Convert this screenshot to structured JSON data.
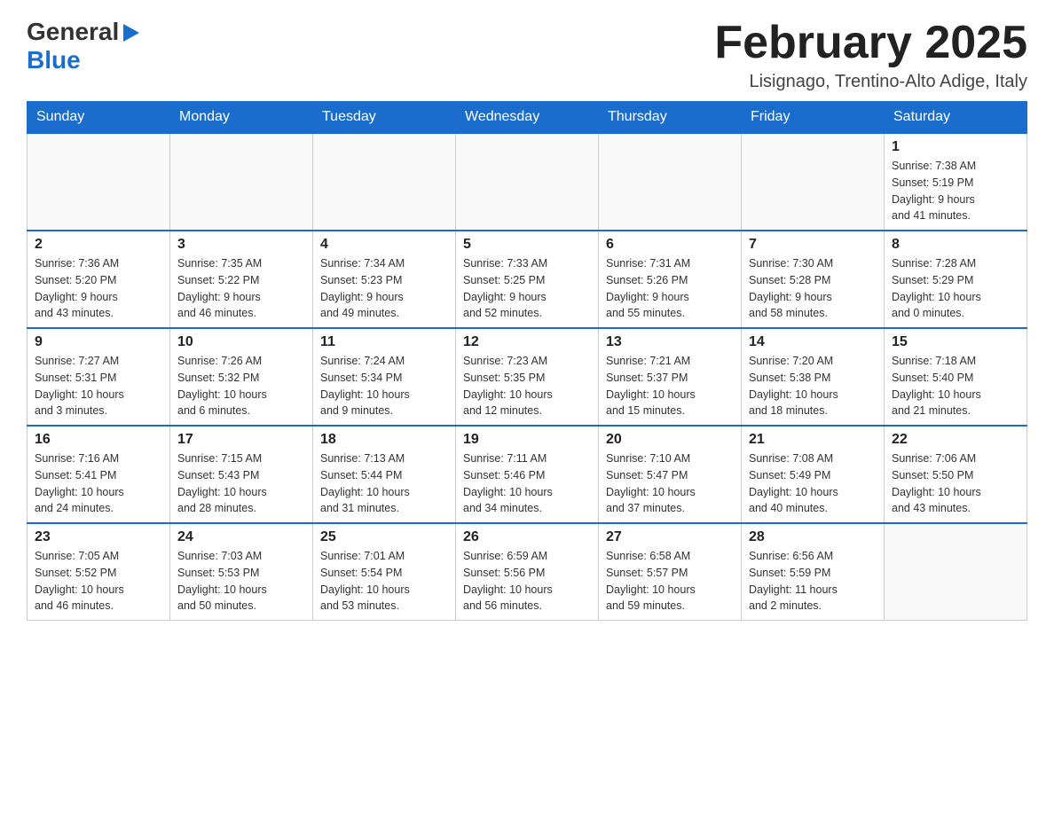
{
  "logo": {
    "general": "General",
    "blue": "Blue"
  },
  "title": "February 2025",
  "subtitle": "Lisignago, Trentino-Alto Adige, Italy",
  "weekdays": [
    "Sunday",
    "Monday",
    "Tuesday",
    "Wednesday",
    "Thursday",
    "Friday",
    "Saturday"
  ],
  "weeks": [
    [
      {
        "day": "",
        "info": ""
      },
      {
        "day": "",
        "info": ""
      },
      {
        "day": "",
        "info": ""
      },
      {
        "day": "",
        "info": ""
      },
      {
        "day": "",
        "info": ""
      },
      {
        "day": "",
        "info": ""
      },
      {
        "day": "1",
        "info": "Sunrise: 7:38 AM\nSunset: 5:19 PM\nDaylight: 9 hours\nand 41 minutes."
      }
    ],
    [
      {
        "day": "2",
        "info": "Sunrise: 7:36 AM\nSunset: 5:20 PM\nDaylight: 9 hours\nand 43 minutes."
      },
      {
        "day": "3",
        "info": "Sunrise: 7:35 AM\nSunset: 5:22 PM\nDaylight: 9 hours\nand 46 minutes."
      },
      {
        "day": "4",
        "info": "Sunrise: 7:34 AM\nSunset: 5:23 PM\nDaylight: 9 hours\nand 49 minutes."
      },
      {
        "day": "5",
        "info": "Sunrise: 7:33 AM\nSunset: 5:25 PM\nDaylight: 9 hours\nand 52 minutes."
      },
      {
        "day": "6",
        "info": "Sunrise: 7:31 AM\nSunset: 5:26 PM\nDaylight: 9 hours\nand 55 minutes."
      },
      {
        "day": "7",
        "info": "Sunrise: 7:30 AM\nSunset: 5:28 PM\nDaylight: 9 hours\nand 58 minutes."
      },
      {
        "day": "8",
        "info": "Sunrise: 7:28 AM\nSunset: 5:29 PM\nDaylight: 10 hours\nand 0 minutes."
      }
    ],
    [
      {
        "day": "9",
        "info": "Sunrise: 7:27 AM\nSunset: 5:31 PM\nDaylight: 10 hours\nand 3 minutes."
      },
      {
        "day": "10",
        "info": "Sunrise: 7:26 AM\nSunset: 5:32 PM\nDaylight: 10 hours\nand 6 minutes."
      },
      {
        "day": "11",
        "info": "Sunrise: 7:24 AM\nSunset: 5:34 PM\nDaylight: 10 hours\nand 9 minutes."
      },
      {
        "day": "12",
        "info": "Sunrise: 7:23 AM\nSunset: 5:35 PM\nDaylight: 10 hours\nand 12 minutes."
      },
      {
        "day": "13",
        "info": "Sunrise: 7:21 AM\nSunset: 5:37 PM\nDaylight: 10 hours\nand 15 minutes."
      },
      {
        "day": "14",
        "info": "Sunrise: 7:20 AM\nSunset: 5:38 PM\nDaylight: 10 hours\nand 18 minutes."
      },
      {
        "day": "15",
        "info": "Sunrise: 7:18 AM\nSunset: 5:40 PM\nDaylight: 10 hours\nand 21 minutes."
      }
    ],
    [
      {
        "day": "16",
        "info": "Sunrise: 7:16 AM\nSunset: 5:41 PM\nDaylight: 10 hours\nand 24 minutes."
      },
      {
        "day": "17",
        "info": "Sunrise: 7:15 AM\nSunset: 5:43 PM\nDaylight: 10 hours\nand 28 minutes."
      },
      {
        "day": "18",
        "info": "Sunrise: 7:13 AM\nSunset: 5:44 PM\nDaylight: 10 hours\nand 31 minutes."
      },
      {
        "day": "19",
        "info": "Sunrise: 7:11 AM\nSunset: 5:46 PM\nDaylight: 10 hours\nand 34 minutes."
      },
      {
        "day": "20",
        "info": "Sunrise: 7:10 AM\nSunset: 5:47 PM\nDaylight: 10 hours\nand 37 minutes."
      },
      {
        "day": "21",
        "info": "Sunrise: 7:08 AM\nSunset: 5:49 PM\nDaylight: 10 hours\nand 40 minutes."
      },
      {
        "day": "22",
        "info": "Sunrise: 7:06 AM\nSunset: 5:50 PM\nDaylight: 10 hours\nand 43 minutes."
      }
    ],
    [
      {
        "day": "23",
        "info": "Sunrise: 7:05 AM\nSunset: 5:52 PM\nDaylight: 10 hours\nand 46 minutes."
      },
      {
        "day": "24",
        "info": "Sunrise: 7:03 AM\nSunset: 5:53 PM\nDaylight: 10 hours\nand 50 minutes."
      },
      {
        "day": "25",
        "info": "Sunrise: 7:01 AM\nSunset: 5:54 PM\nDaylight: 10 hours\nand 53 minutes."
      },
      {
        "day": "26",
        "info": "Sunrise: 6:59 AM\nSunset: 5:56 PM\nDaylight: 10 hours\nand 56 minutes."
      },
      {
        "day": "27",
        "info": "Sunrise: 6:58 AM\nSunset: 5:57 PM\nDaylight: 10 hours\nand 59 minutes."
      },
      {
        "day": "28",
        "info": "Sunrise: 6:56 AM\nSunset: 5:59 PM\nDaylight: 11 hours\nand 2 minutes."
      },
      {
        "day": "",
        "info": ""
      }
    ]
  ]
}
